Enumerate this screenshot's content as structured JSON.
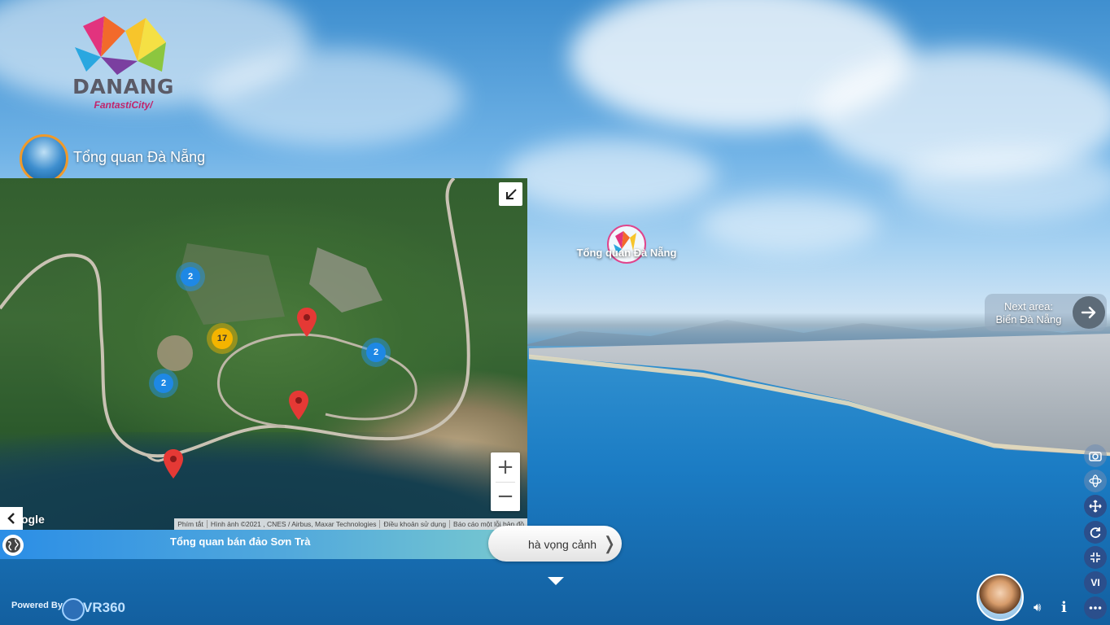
{
  "brand": {
    "name": "DANANG",
    "tagline": "FantastiCity/"
  },
  "scene": {
    "title": "Tổng quan Đà Nẵng"
  },
  "hotspot": {
    "label": "Tổng quan Đà Nẵng"
  },
  "next_area": {
    "line1": "Next area:",
    "line2": "Biển Đà Nẵng",
    "icon": "arrow-right-icon"
  },
  "map": {
    "clusters": [
      {
        "count": "2",
        "color": "blue"
      },
      {
        "count": "17",
        "color": "yellow"
      },
      {
        "count": "2",
        "color": "blue"
      },
      {
        "count": "2",
        "color": "blue"
      }
    ],
    "pins": 3,
    "google_label": "ogle",
    "attribution": [
      "Phím tắt",
      "Hình ảnh ©2021 , CNES / Airbus, Maxar Technologies",
      "Điều khoản sử dụng",
      "Báo cáo một lỗi bản đồ"
    ],
    "zoom_in": "+",
    "zoom_out": "−",
    "caption": "Tổng quan bán đảo Sơn Trà"
  },
  "scene_button": {
    "label": "hà vọng cảnh"
  },
  "footer": {
    "powered_by": "Powered By",
    "vendor": "VR360"
  },
  "toolbar": {
    "language": "VI"
  }
}
